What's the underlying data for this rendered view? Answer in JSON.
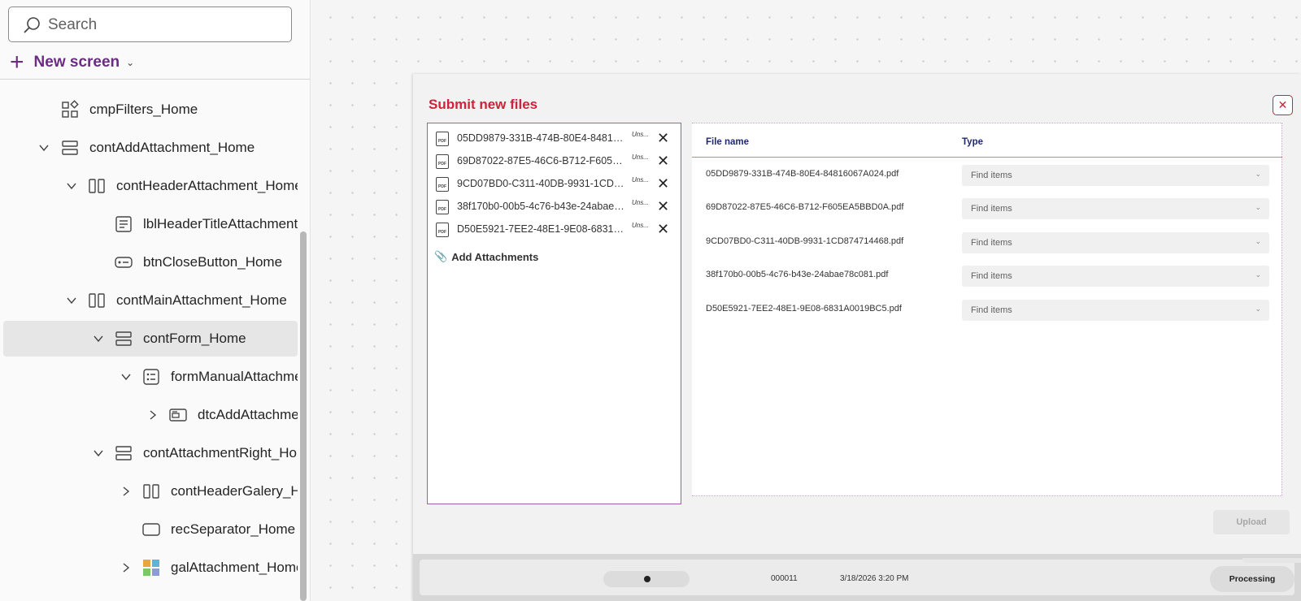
{
  "search": {
    "placeholder": "Search",
    "icon": "search-icon"
  },
  "new_screen": {
    "label": "New screen",
    "icon": "plus-icon"
  },
  "tree": {
    "items": [
      {
        "label": "cmpFilters_Home",
        "icon": "component-icon"
      },
      {
        "label": "contAddAttachment_Home",
        "icon": "vertical-container-icon",
        "expanded": true
      },
      {
        "label": "contHeaderAttachment_Home",
        "icon": "horizontal-container-icon",
        "expanded": true
      },
      {
        "label": "lblHeaderTitleAttachment_Home",
        "icon": "label-icon"
      },
      {
        "label": "btnCloseButton_Home",
        "icon": "button-icon"
      },
      {
        "label": "contMainAttachment_Home",
        "icon": "horizontal-container-icon",
        "expanded": true
      },
      {
        "label": "contForm_Home",
        "icon": "vertical-container-icon",
        "expanded": true,
        "selected": true
      },
      {
        "label": "formManualAttachment_Home",
        "icon": "form-icon",
        "expanded": true
      },
      {
        "label": "dtcAddAttachment_Home",
        "icon": "data-card-icon",
        "expanded": false
      },
      {
        "label": "contAttachmentRight_Home",
        "icon": "vertical-container-icon",
        "expanded": true
      },
      {
        "label": "contHeaderGalery_Home",
        "icon": "horizontal-container-icon",
        "expanded": false
      },
      {
        "label": "recSeparator_Home",
        "icon": "rectangle-icon"
      },
      {
        "label": "galAttachment_Home",
        "icon": "gallery-icon",
        "expanded": false
      }
    ]
  },
  "dialog": {
    "title": "Submit new files",
    "close_icon": "close-icon",
    "attachments": [
      {
        "name": "05DD9879-331B-474B-80E4-84816067A024.pdf",
        "status": "Uns..."
      },
      {
        "name": "69D87022-87E5-46C6-B712-F605EA5BBD0A.pdf",
        "status": "Uns..."
      },
      {
        "name": "9CD07BD0-C311-40DB-9931-1CD874714468.pdf",
        "status": "Uns..."
      },
      {
        "name": "38f170b0-00b5-4c76-b43e-24abae78c081.pdf",
        "status": "Uns..."
      },
      {
        "name": "D50E5921-7EE2-48E1-9E08-6831A0019BC5.pdf",
        "status": "Uns..."
      }
    ],
    "add_attachments_label": "Add Attachments",
    "table": {
      "col_file_name": "File name",
      "col_type": "Type",
      "rows": [
        {
          "file": "05DD9879-331B-474B-80E4-84816067A024.pdf",
          "type_placeholder": "Find items"
        },
        {
          "file": "69D87022-87E5-46C6-B712-F605EA5BBD0A.pdf",
          "type_placeholder": "Find items"
        },
        {
          "file": "9CD07BD0-C311-40DB-9931-1CD874714468.pdf",
          "type_placeholder": "Find items"
        },
        {
          "file": "38f170b0-00b5-4c76-b43e-24abae78c081.pdf",
          "type_placeholder": "Find items"
        },
        {
          "file": "D50E5921-7EE2-48E1-9E08-6831A0019BC5.pdf",
          "type_placeholder": "Find items"
        }
      ]
    },
    "upload_label": "Upload"
  },
  "footer": {
    "id": "000011",
    "datetime": "3/18/2026 3:20 PM",
    "status": "Processing"
  },
  "colors": {
    "accent_purple": "#6b2c83",
    "title_red": "#d0223a",
    "header_navy": "#1f2a6d"
  }
}
